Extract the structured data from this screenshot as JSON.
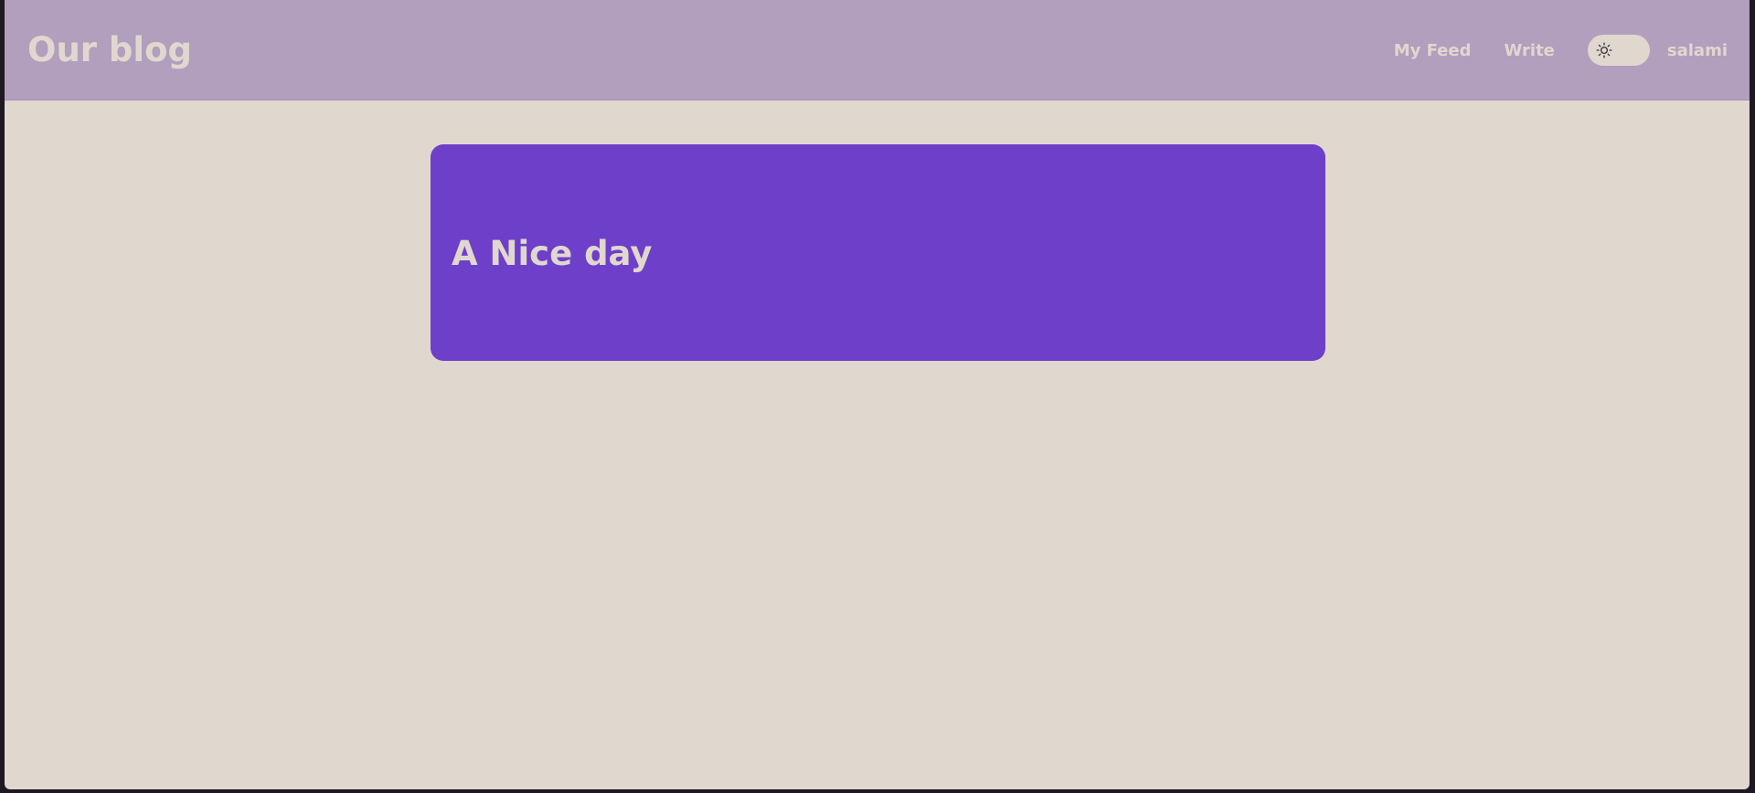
{
  "header": {
    "brand": "Our blog",
    "nav": {
      "my_feed": "My Feed",
      "write": "Write",
      "username": "salami"
    },
    "theme_toggle": {
      "icon": "sun-icon",
      "state": "light"
    }
  },
  "main": {
    "posts": [
      {
        "title": "A Nice day"
      }
    ]
  },
  "colors": {
    "header_bg": "#b29ebd",
    "page_bg": "#e0d8cf",
    "card_bg": "#6e3fc8",
    "text_light": "#e0d8cf"
  }
}
